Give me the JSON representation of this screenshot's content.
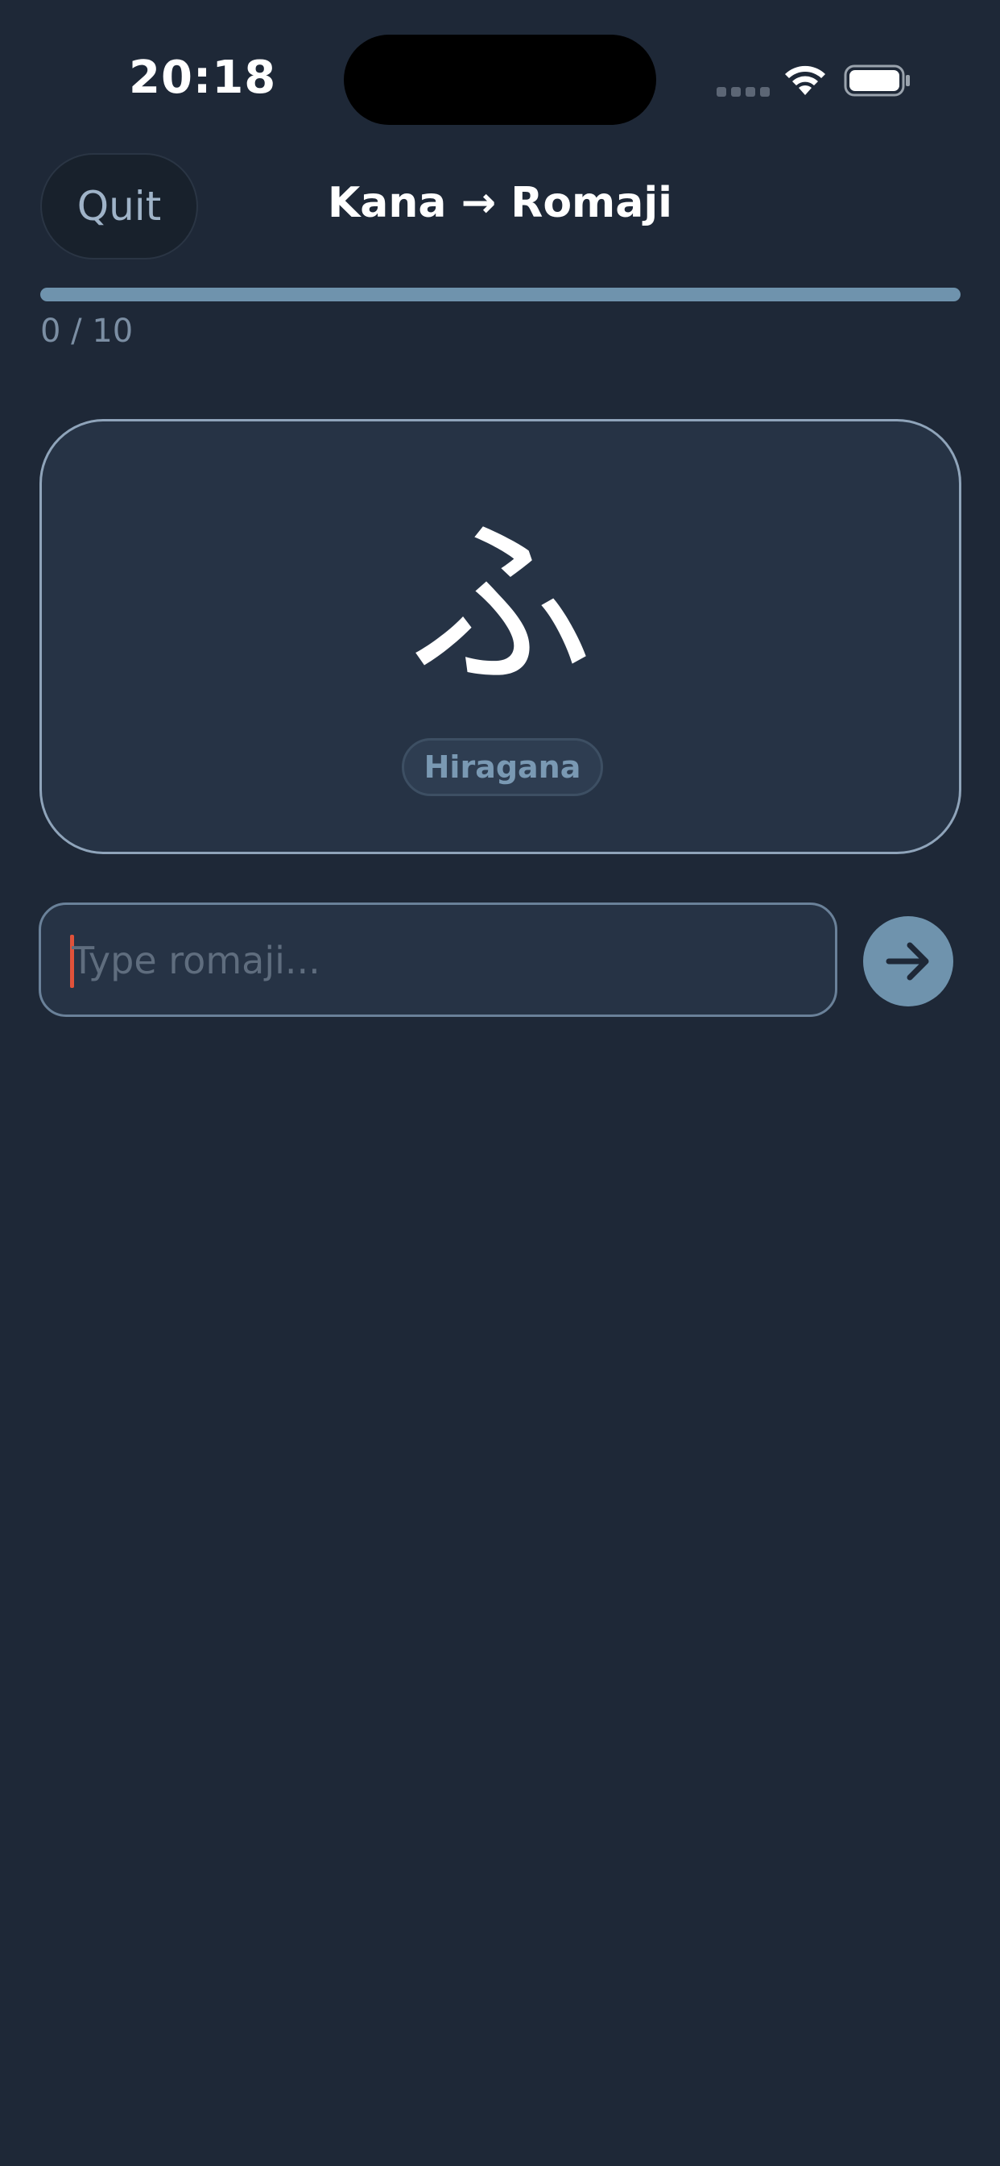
{
  "status_bar": {
    "time": "20:18"
  },
  "header": {
    "quit_label": "Quit",
    "title": "Kana → Romaji"
  },
  "progress": {
    "text": "0 / 10",
    "fraction": 0
  },
  "card": {
    "kana": "ふ",
    "script_badge": "Hiragana"
  },
  "answer": {
    "value": "",
    "placeholder": "Type romaji..."
  },
  "icons": {
    "submit": "arrow-right-icon",
    "wifi": "wifi-icon",
    "battery": "battery-icon",
    "signal": "cellular-signal-icon"
  },
  "colors": {
    "background": "#1e2837",
    "card": "#263345",
    "accent": "#6f93ad",
    "caret": "#e0523a"
  }
}
